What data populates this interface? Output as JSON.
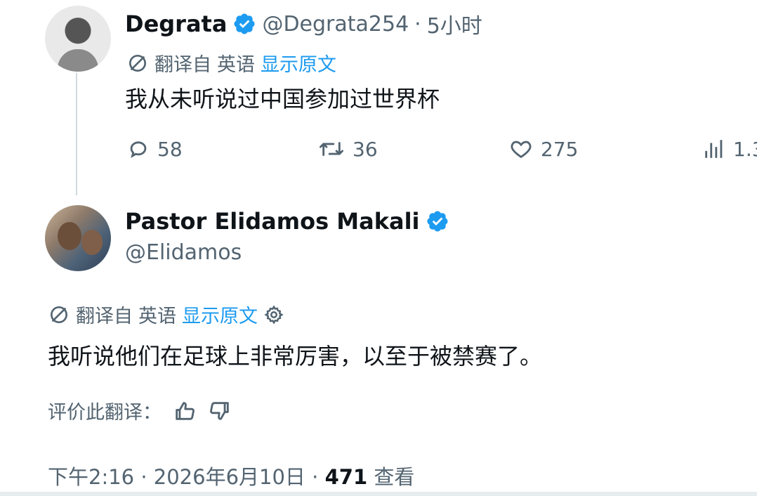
{
  "thread": {
    "tweet1": {
      "author_name": "Degrata",
      "author_handle": "@Degrata254",
      "time": "5小时",
      "translated_from_prefix": "翻译自",
      "translated_from_lang": "英语",
      "show_original": "显示原文",
      "text": "我从未听说过中国参加过世界杯",
      "reply_count": "58",
      "retweet_count": "36",
      "like_count": "275",
      "views_count": "1.3"
    },
    "tweet2": {
      "author_name": "Pastor Elidamos Makali",
      "author_handle": "@Elidamos",
      "translated_from_prefix": "翻译自",
      "translated_from_lang": "英语",
      "show_original": "显示原文",
      "text": "我听说他们在足球上非常厉害，以至于被禁赛了。",
      "rate_translation": "评价此翻译：",
      "footer_time": "下午2:16 · 2026年6月10日 · ",
      "footer_views": "471",
      "footer_views_label": "查看"
    }
  },
  "colors": {
    "text_primary": "#0f1419",
    "text_secondary": "#536471",
    "accent_blue": "#1d9bf0",
    "verified_blue": "#1d9bf0",
    "thread_line": "#cfd9de"
  },
  "icons": {
    "verified": "verified-badge-icon",
    "translate": "translate-icon",
    "reply": "reply-icon",
    "retweet": "retweet-icon",
    "like": "heart-icon",
    "views": "views-icon",
    "settings": "gear-icon",
    "thumbs_up": "thumbs-up-icon",
    "thumbs_down": "thumbs-down-icon"
  }
}
